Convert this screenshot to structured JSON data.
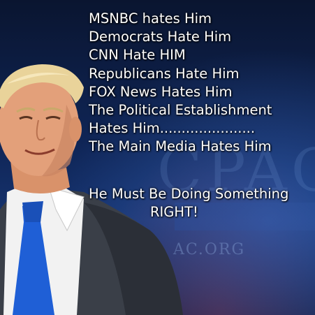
{
  "backdrop": {
    "letters": "CPAC",
    "url": "AC.ORG"
  },
  "caption": {
    "lines": [
      "MSNBC hates Him",
      "Democrats Hate Him",
      "CNN Hate HIM",
      "Republicans Hate Him",
      "FOX News Hates Him",
      "The Political Establishment",
      "Hates Him......................",
      "The Main Media Hates Him"
    ],
    "conclusion_line1": "He Must Be Doing Something",
    "conclusion_line2": "RIGHT!"
  },
  "colors": {
    "background": "#0f2556",
    "text": "#ffffff",
    "tie": "#1f5fd6",
    "suit": "#3a3f48"
  }
}
